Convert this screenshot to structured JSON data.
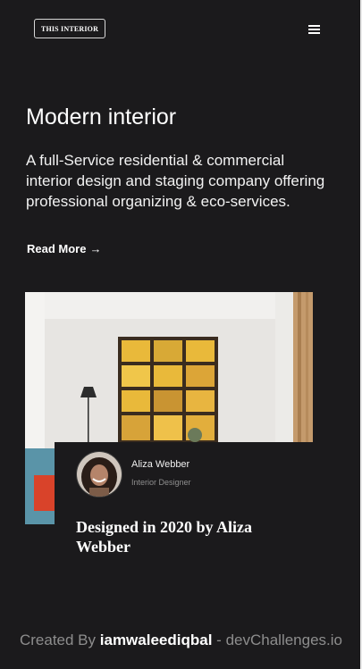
{
  "header": {
    "logo_text": "THIS INTERIOR",
    "menu_icon": "hamburger-menu-icon"
  },
  "hero": {
    "title": "Modern interior",
    "description": "A full-Service residential & commercial interior design and staging company offering professional organizing & eco-services.",
    "read_more_label": "Read More",
    "read_more_arrow": "→"
  },
  "card": {
    "author_name": "Aliza Webber",
    "author_role": "Interior Designer",
    "title": "Designed in 2020 by Aliza Webber"
  },
  "footer": {
    "prefix": "Created By",
    "author": "iamwaleediqbal",
    "separator": "-",
    "site": "devChallenges.io"
  },
  "colors": {
    "background": "#1b1a1c",
    "text": "#ffffff",
    "muted": "#8d8d8d"
  }
}
